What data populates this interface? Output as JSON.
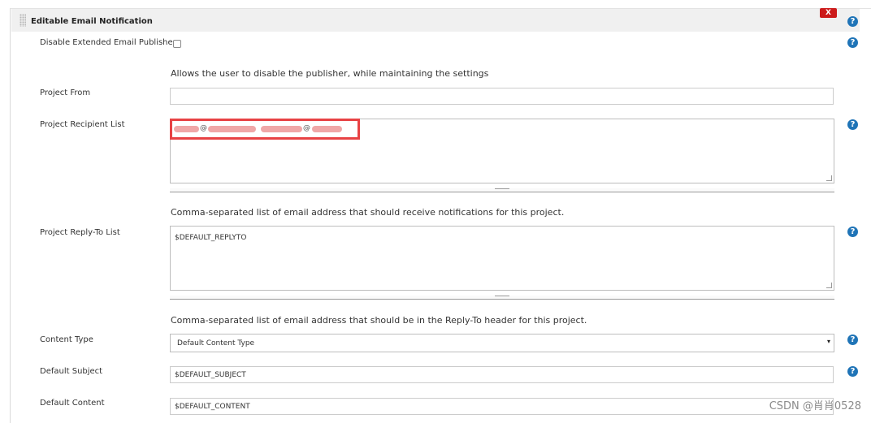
{
  "section": {
    "title": "Editable Email Notification",
    "delete_label": "X",
    "help_symbol": "?"
  },
  "fields": {
    "disable_publisher": {
      "label": "Disable Extended Email Publisher",
      "checked": false,
      "description": "Allows the user to disable the publisher, while maintaining the settings"
    },
    "project_from": {
      "label": "Project From",
      "value": ""
    },
    "recipient_list": {
      "label": "Project Recipient List",
      "value_redacted": true,
      "at_symbol": "@",
      "description": "Comma-separated list of email address that should receive notifications for this project."
    },
    "reply_to": {
      "label": "Project Reply-To List",
      "value": "$DEFAULT_REPLYTO",
      "description": "Comma-separated list of email address that should be in the Reply-To header for this project."
    },
    "content_type": {
      "label": "Content Type",
      "selected": "Default Content Type"
    },
    "default_subject": {
      "label": "Default Subject",
      "value": "$DEFAULT_SUBJECT"
    },
    "default_content": {
      "label": "Default Content",
      "value": "$DEFAULT_CONTENT"
    }
  },
  "colors": {
    "help_icon": "#1f74b7",
    "delete_button": "#cc1b1b",
    "highlight_box": "#e84244",
    "redaction": "#f0a7a7"
  },
  "watermark": "CSDN @肖肖0528"
}
